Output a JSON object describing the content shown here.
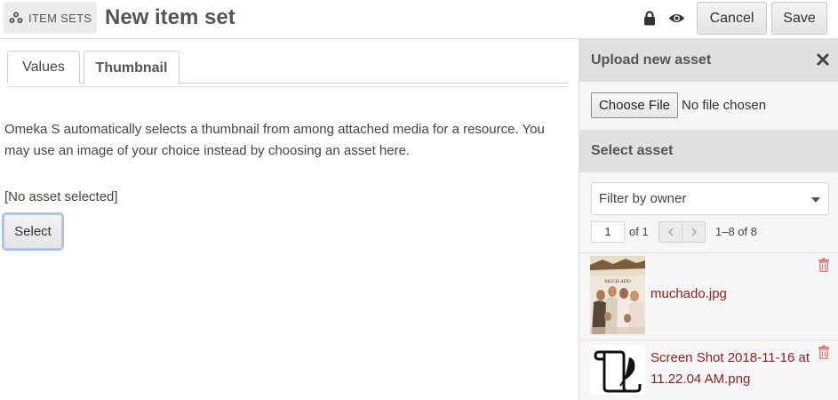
{
  "header": {
    "breadcrumb": "ITEM SETS",
    "breadcrumb_icon": "sitemap-icon",
    "title": "New item set",
    "cancel_label": "Cancel",
    "save_label": "Save"
  },
  "tabs": [
    {
      "label": "Values",
      "active": false
    },
    {
      "label": "Thumbnail",
      "active": true
    }
  ],
  "main": {
    "description": "Omeka S automatically selects a thumbnail from among attached media for a resource. You may use an image of your choice instead by choosing an asset here.",
    "no_asset": "[No asset selected]",
    "select_label": "Select"
  },
  "sidebar": {
    "upload_title": "Upload new asset",
    "choose_file_label": "Choose File",
    "no_file_text": "No file chosen",
    "select_title": "Select asset",
    "filter_label": "Filter by owner",
    "page_value": "1",
    "page_of": "of 1",
    "range": "1–8 of 8",
    "assets": [
      {
        "name": "muchado.jpg"
      },
      {
        "name": "Screen Shot 2018-11-16 at 11.22.04 AM.png"
      }
    ]
  },
  "colors": {
    "accent_link": "#8c1f1f",
    "trash": "#d9534f",
    "focus_ring": "#9ec4f2"
  }
}
